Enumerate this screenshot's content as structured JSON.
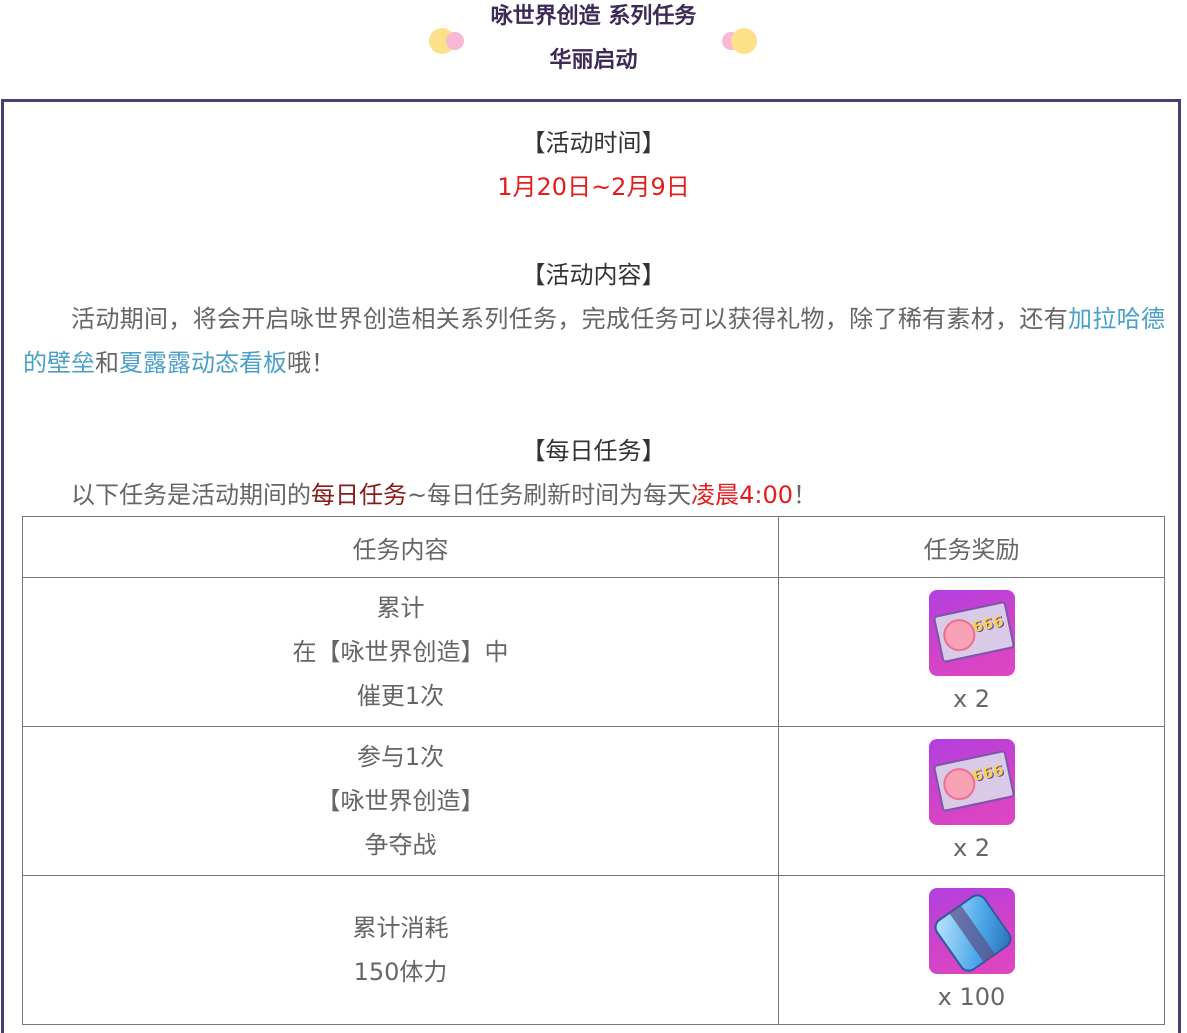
{
  "header": {
    "title_line1": "咏世界创造 系列任务",
    "title_line2": "华丽启动",
    "dot_colors": [
      "#fde08a",
      "#f7b8d6"
    ]
  },
  "time_section": {
    "heading": "【活动时间】",
    "dates": "1月20日~2月9日"
  },
  "content_section": {
    "heading": "【活动内容】",
    "text_before": "活动期间，将会开启咏世界创造相关系列任务，完成任务可以获得礼物，除了稀有素材，还有",
    "link1": "加拉哈德的壁垒",
    "text_mid": "和",
    "link2": "夏露露动态看板",
    "text_after": "哦！"
  },
  "daily_section": {
    "heading": "【每日任务】",
    "text_before": "以下任务是活动期间的",
    "highlight1": "每日任务",
    "text_mid": "~每日任务刷新时间为每天",
    "highlight2": "凌晨4:00",
    "text_after": "！"
  },
  "table": {
    "headers": [
      "任务内容",
      "任务奖励"
    ],
    "rows": [
      {
        "task_lines": [
          "累计",
          "在【咏世界创造】中",
          "催更1次"
        ],
        "reward_icon": "ticket-666-icon",
        "reward_count": "x 2"
      },
      {
        "task_lines": [
          "参与1次",
          "【咏世界创造】",
          "争夺战"
        ],
        "reward_icon": "ticket-666-icon",
        "reward_count": "x 2"
      },
      {
        "task_lines": [
          "累计消耗",
          "150体力"
        ],
        "reward_icon": "stamina-battery-icon",
        "reward_count": "x 100"
      }
    ]
  },
  "icon_labels": {
    "ticket_number": "666"
  },
  "colors": {
    "frame_border": "#4b3f6e",
    "accent_red": "#e31c1c",
    "accent_darkred": "#8b1a1a",
    "link_blue": "#4aa0c9",
    "reward_icon_bg": "#c640d6"
  }
}
